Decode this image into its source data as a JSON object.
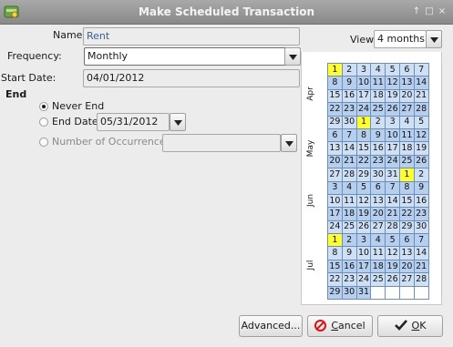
{
  "window": {
    "title": "Make Scheduled Transaction",
    "controls": [
      "↑",
      "□",
      "×"
    ]
  },
  "form": {
    "name_label": "Name:",
    "name_value": "Rent",
    "frequency_label": "Frequency:",
    "frequency_value": "Monthly",
    "start_date_label": "Start Date:",
    "start_date_value": "04/01/2012"
  },
  "end": {
    "heading": "End",
    "never_label": "Never End",
    "end_date_label": "End Date:",
    "end_date_value": "05/31/2012",
    "occurrences_label": "Number of Occurrences:",
    "occurrences_value": "",
    "selected": "never"
  },
  "calendar": {
    "view_label": "View:",
    "view_value": "4 months",
    "months": [
      "Apr",
      "May",
      "Jun",
      "Jul"
    ],
    "rows": [
      [
        [
          1,
          "m"
        ],
        [
          2
        ],
        [
          3
        ],
        [
          4
        ],
        [
          5
        ],
        [
          6
        ],
        [
          7
        ]
      ],
      [
        [
          8
        ],
        [
          9
        ],
        [
          10
        ],
        [
          11
        ],
        [
          12
        ],
        [
          13
        ],
        [
          14
        ]
      ],
      [
        [
          15
        ],
        [
          16
        ],
        [
          17
        ],
        [
          18
        ],
        [
          19
        ],
        [
          20
        ],
        [
          21
        ]
      ],
      [
        [
          22
        ],
        [
          23
        ],
        [
          24
        ],
        [
          25
        ],
        [
          26
        ],
        [
          27
        ],
        [
          28
        ]
      ],
      [
        [
          29
        ],
        [
          30
        ],
        [
          1,
          "m"
        ],
        [
          2
        ],
        [
          3
        ],
        [
          4
        ],
        [
          5
        ]
      ],
      [
        [
          6
        ],
        [
          7
        ],
        [
          8
        ],
        [
          9
        ],
        [
          10
        ],
        [
          11
        ],
        [
          12
        ]
      ],
      [
        [
          13
        ],
        [
          14
        ],
        [
          15
        ],
        [
          16
        ],
        [
          17
        ],
        [
          18
        ],
        [
          19
        ]
      ],
      [
        [
          20
        ],
        [
          21
        ],
        [
          22
        ],
        [
          23
        ],
        [
          24
        ],
        [
          25
        ],
        [
          26
        ]
      ],
      [
        [
          27
        ],
        [
          28
        ],
        [
          29
        ],
        [
          30
        ],
        [
          31
        ],
        [
          1,
          "m"
        ],
        [
          2
        ]
      ],
      [
        [
          3
        ],
        [
          4
        ],
        [
          5
        ],
        [
          6
        ],
        [
          7
        ],
        [
          8
        ],
        [
          9
        ]
      ],
      [
        [
          10
        ],
        [
          11
        ],
        [
          12
        ],
        [
          13
        ],
        [
          14
        ],
        [
          15
        ],
        [
          16
        ]
      ],
      [
        [
          17
        ],
        [
          18
        ],
        [
          19
        ],
        [
          20
        ],
        [
          21
        ],
        [
          22
        ],
        [
          23
        ]
      ],
      [
        [
          24
        ],
        [
          25
        ],
        [
          26
        ],
        [
          27
        ],
        [
          28
        ],
        [
          29
        ],
        [
          30
        ]
      ],
      [
        [
          1,
          "m"
        ],
        [
          2
        ],
        [
          3
        ],
        [
          4
        ],
        [
          5
        ],
        [
          6
        ],
        [
          7
        ]
      ],
      [
        [
          8
        ],
        [
          9
        ],
        [
          10
        ],
        [
          11
        ],
        [
          12
        ],
        [
          13
        ],
        [
          14
        ]
      ],
      [
        [
          15
        ],
        [
          16
        ],
        [
          17
        ],
        [
          18
        ],
        [
          19
        ],
        [
          20
        ],
        [
          21
        ]
      ],
      [
        [
          22
        ],
        [
          23
        ],
        [
          24
        ],
        [
          25
        ],
        [
          26
        ],
        [
          27
        ],
        [
          28
        ]
      ],
      [
        [
          29
        ],
        [
          30
        ],
        [
          31
        ],
        [
          ""
        ],
        [
          ""
        ],
        [
          ""
        ],
        [
          ""
        ]
      ]
    ],
    "colors": {
      "cell": "#cfe0f5",
      "cell_alt": "#b6cfee",
      "marked": "#ffff33",
      "border": "#6d8fb5"
    }
  },
  "buttons": {
    "advanced": "Advanced...",
    "cancel": "Cancel",
    "ok": "OK"
  },
  "icons": {
    "title": "app-icon",
    "cancel": "cancel-icon",
    "ok": "checkmark-icon"
  }
}
